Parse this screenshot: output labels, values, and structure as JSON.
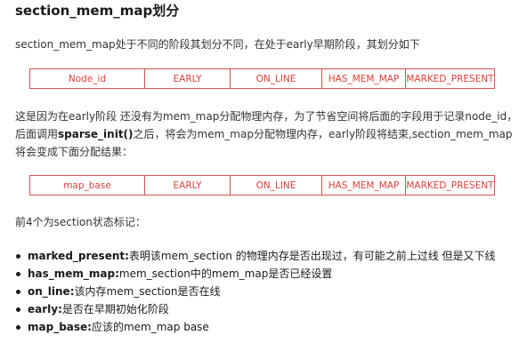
{
  "title": "section_mem_map划分",
  "intro": "section_mem_map处于不同的阶段其划分不同，在处于early早期阶段，其划分如下",
  "table_early": [
    "Node_id",
    "EARLY",
    "ON_LINE",
    "HAS_MEM_MAP",
    "MARKED_PRESENT"
  ],
  "explain": {
    "part1": "这是因为在early阶段 还没有为mem_map分配物理内存，为了节省空间将后面的字段用于记录node_id，后面调用",
    "func": "sparse_init()",
    "part2": "之后，将会为mem_map分配物理内存，early阶段将结束,section_mem_map将会变成下面分配结果："
  },
  "table_final": [
    "map_base",
    "EARLY",
    "ON_LINE",
    "HAS_MEM_MAP",
    "MARKED_PRESENT"
  ],
  "flags_intro": "前4个为section状态标记：",
  "flags": [
    {
      "name": "marked_present:",
      "desc": "表明该mem_section 的物理内存是否出现过，有可能之前上过线 但是又下线"
    },
    {
      "name": "has_mem_map:",
      "desc": "mem_section中的mem_map是否已经设置"
    },
    {
      "name": "on_line:",
      "desc": "该内存mem_section是否在线"
    },
    {
      "name": "early:",
      "desc": "是否在早期初始化阶段"
    },
    {
      "name": "map_base:",
      "desc": "应该的mem_map base"
    }
  ]
}
